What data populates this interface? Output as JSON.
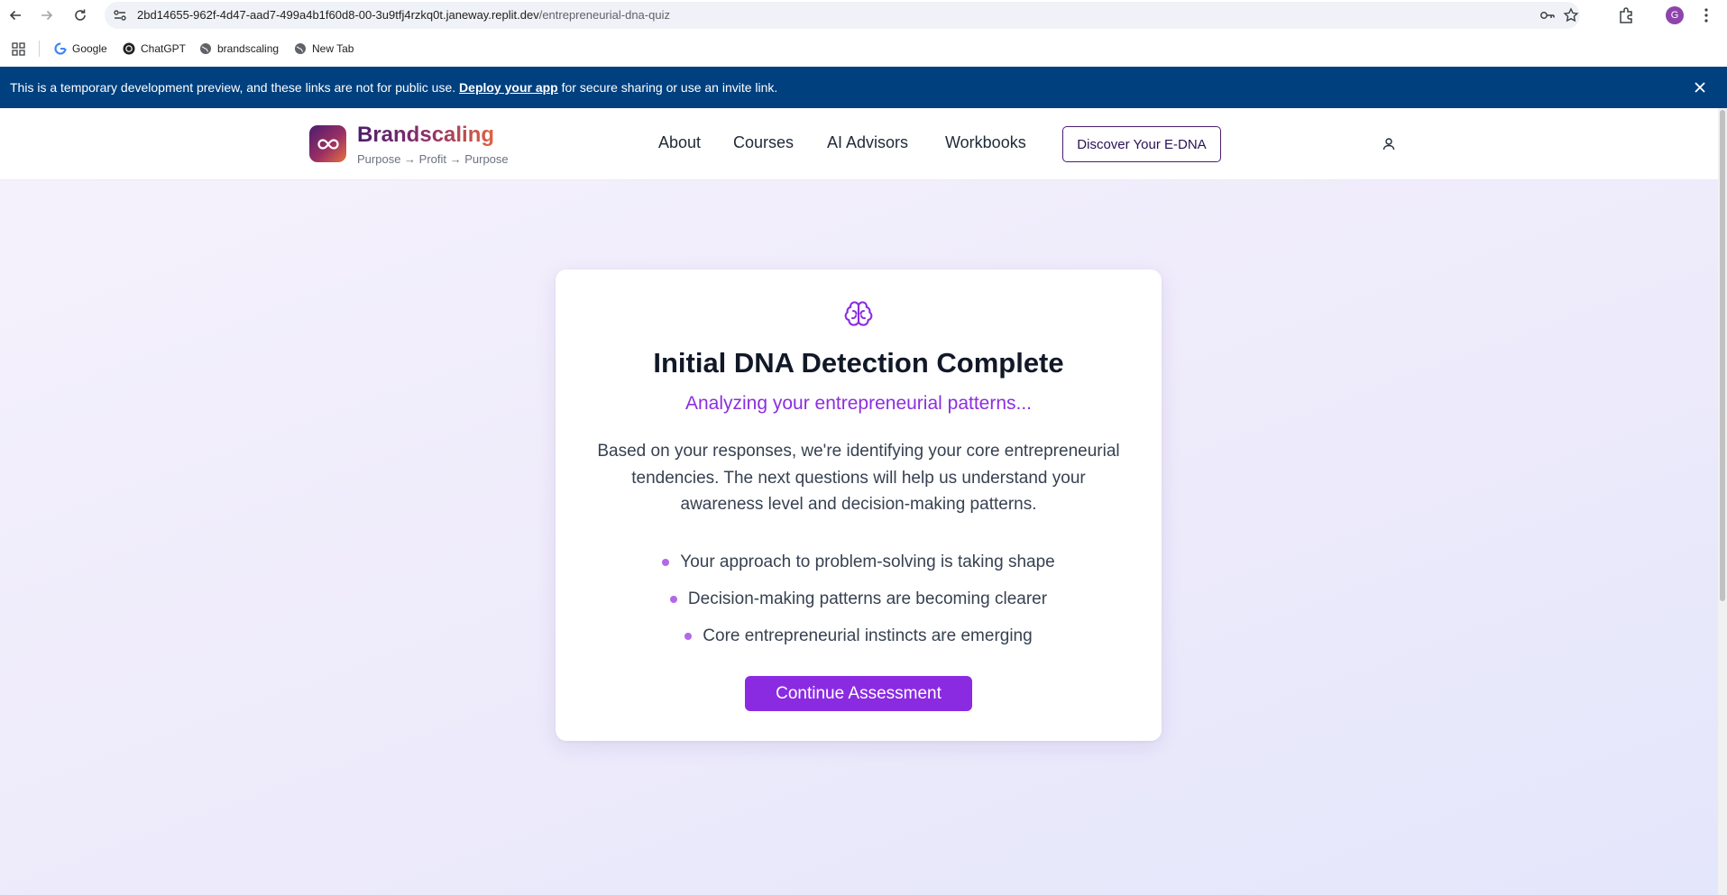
{
  "browser": {
    "url_host": "2bd14655-962f-4d47-aad7-499a4b1f60d8-00-3u9tfj4rzkq0t.janeway.replit.dev",
    "url_path": "/entrepreneurial-dna-quiz",
    "profile_initial": "G",
    "bookmarks": [
      {
        "label": "Google",
        "icon": "google-icon"
      },
      {
        "label": "ChatGPT",
        "icon": "chatgpt-icon"
      },
      {
        "label": "brandscaling",
        "icon": "globe-icon"
      },
      {
        "label": "New Tab",
        "icon": "globe-icon"
      }
    ]
  },
  "banner": {
    "text_before": "This is a temporary development preview, and these links are not for public use. ",
    "link": "Deploy your app",
    "text_after": " for secure sharing or use an invite link."
  },
  "header": {
    "brand": "Brandscaling",
    "tagline": "Purpose → Profit → Purpose",
    "nav": [
      "About",
      "Courses",
      "AI Advisors",
      "Workbooks"
    ],
    "cta": "Discover Your E-DNA"
  },
  "card": {
    "icon": "brain-icon",
    "title": "Initial DNA Detection Complete",
    "subtitle": "Analyzing your entrepreneurial patterns...",
    "body": "Based on your responses, we're identifying your core entrepreneurial tendencies. The next questions will help us understand your awareness level and decision-making patterns.",
    "insights": [
      "Your approach to problem-solving is taking shape",
      "Decision-making patterns are becoming clearer",
      "Core entrepreneurial instincts are emerging"
    ],
    "button": "Continue Assessment"
  },
  "colors": {
    "banner": "#00407f",
    "accent": "#8a2be2",
    "brand_dark": "#4c1d6e",
    "brand_orange": "#e8713e"
  }
}
